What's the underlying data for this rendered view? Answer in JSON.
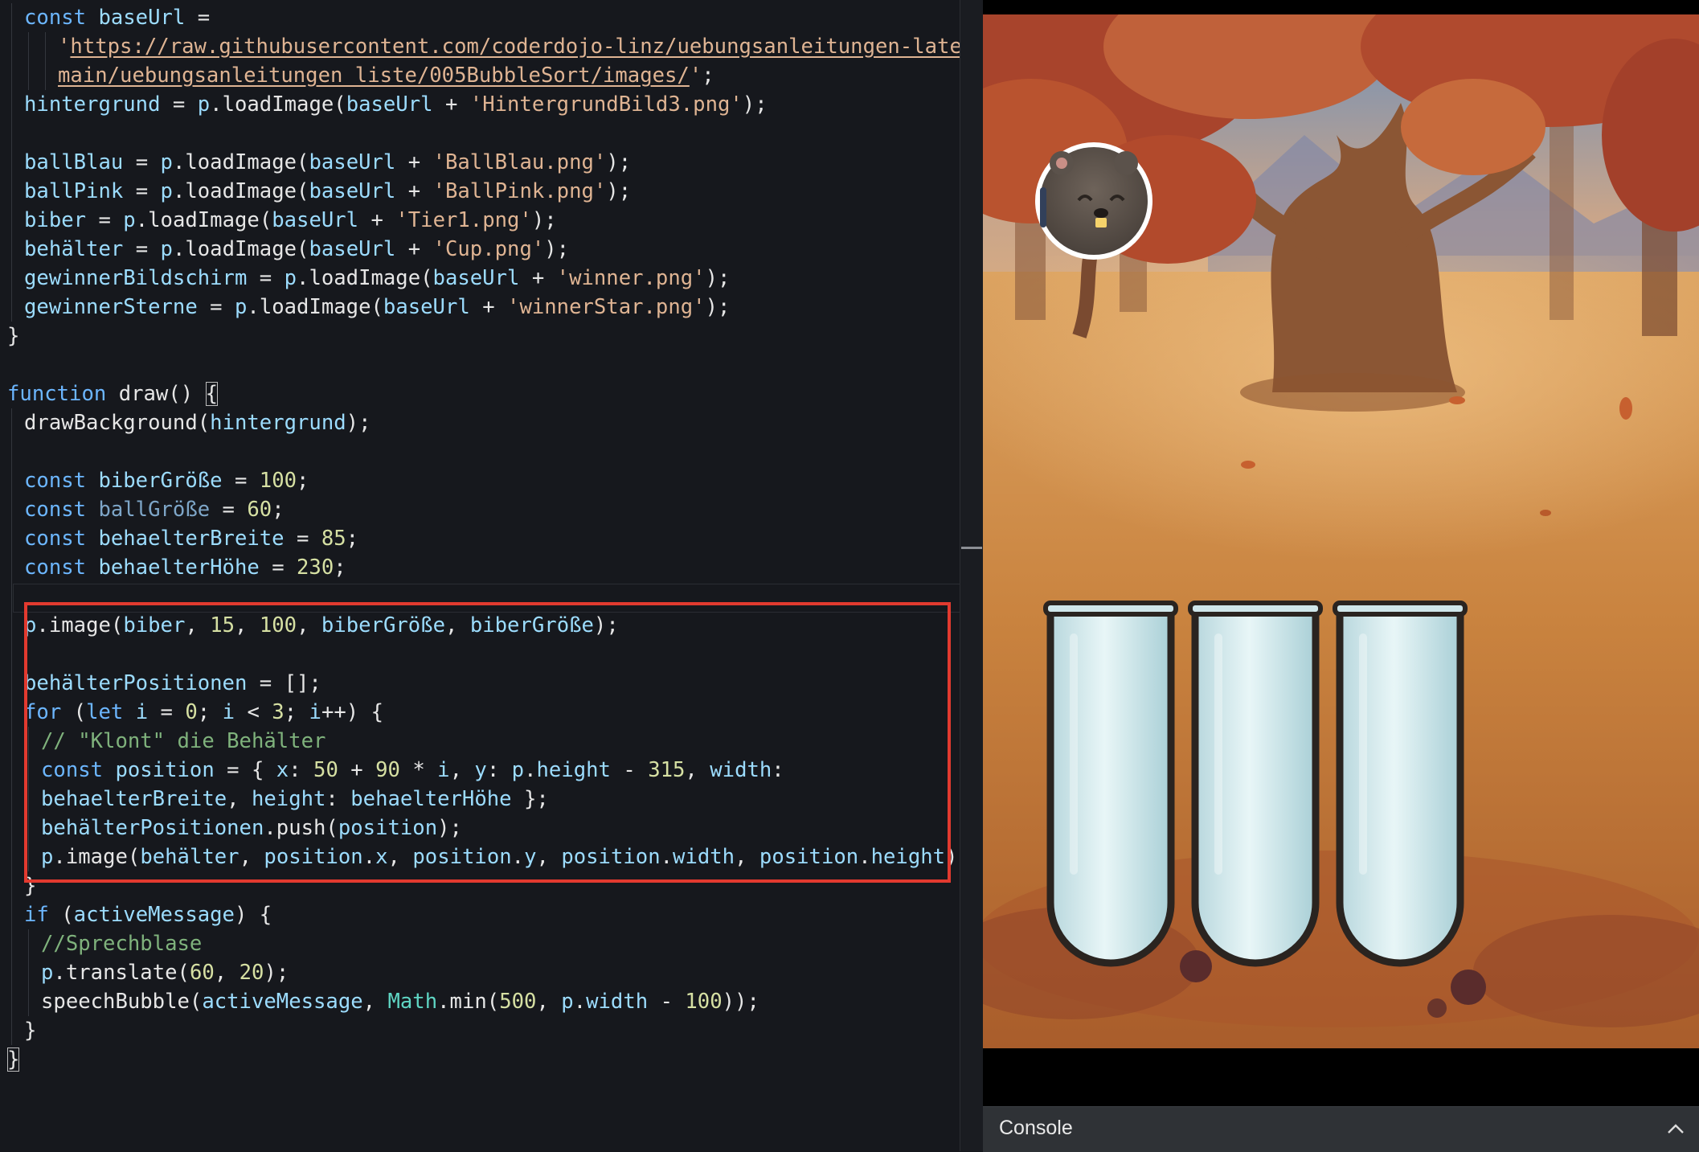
{
  "editor": {
    "language": "javascript",
    "lines": [
      [
        {
          "t": "const ",
          "c": "kw"
        },
        {
          "t": "baseUrl",
          "c": "var"
        },
        {
          "t": " =",
          "c": "p"
        }
      ],
      [
        {
          "t": "'",
          "c": "str"
        },
        {
          "t": "https://raw.githubusercontent.com/coderdojo-linz/uebungsanleitungen-latex/",
          "c": "url"
        }
      ],
      [
        {
          "t": "main/uebungsanleitungen_liste/005BubbleSort/images/",
          "c": "url"
        },
        {
          "t": "'",
          "c": "str"
        },
        {
          "t": ";",
          "c": "p"
        }
      ],
      [
        {
          "t": "hintergrund",
          "c": "var"
        },
        {
          "t": " = ",
          "c": "p"
        },
        {
          "t": "p",
          "c": "var"
        },
        {
          "t": ".",
          "c": "p"
        },
        {
          "t": "loadImage",
          "c": "fn"
        },
        {
          "t": "(",
          "c": "p"
        },
        {
          "t": "baseUrl",
          "c": "var"
        },
        {
          "t": " + ",
          "c": "p"
        },
        {
          "t": "'HintergrundBild3.png'",
          "c": "str"
        },
        {
          "t": ");",
          "c": "p"
        }
      ],
      [],
      [
        {
          "t": "ballBlau",
          "c": "var"
        },
        {
          "t": " = ",
          "c": "p"
        },
        {
          "t": "p",
          "c": "var"
        },
        {
          "t": ".",
          "c": "p"
        },
        {
          "t": "loadImage",
          "c": "fn"
        },
        {
          "t": "(",
          "c": "p"
        },
        {
          "t": "baseUrl",
          "c": "var"
        },
        {
          "t": " + ",
          "c": "p"
        },
        {
          "t": "'BallBlau.png'",
          "c": "str"
        },
        {
          "t": ");",
          "c": "p"
        }
      ],
      [
        {
          "t": "ballPink",
          "c": "var"
        },
        {
          "t": " = ",
          "c": "p"
        },
        {
          "t": "p",
          "c": "var"
        },
        {
          "t": ".",
          "c": "p"
        },
        {
          "t": "loadImage",
          "c": "fn"
        },
        {
          "t": "(",
          "c": "p"
        },
        {
          "t": "baseUrl",
          "c": "var"
        },
        {
          "t": " + ",
          "c": "p"
        },
        {
          "t": "'BallPink.png'",
          "c": "str"
        },
        {
          "t": ");",
          "c": "p"
        }
      ],
      [
        {
          "t": "biber",
          "c": "var"
        },
        {
          "t": " = ",
          "c": "p"
        },
        {
          "t": "p",
          "c": "var"
        },
        {
          "t": ".",
          "c": "p"
        },
        {
          "t": "loadImage",
          "c": "fn"
        },
        {
          "t": "(",
          "c": "p"
        },
        {
          "t": "baseUrl",
          "c": "var"
        },
        {
          "t": " + ",
          "c": "p"
        },
        {
          "t": "'Tier1.png'",
          "c": "str"
        },
        {
          "t": ");",
          "c": "p"
        }
      ],
      [
        {
          "t": "behälter",
          "c": "var"
        },
        {
          "t": " = ",
          "c": "p"
        },
        {
          "t": "p",
          "c": "var"
        },
        {
          "t": ".",
          "c": "p"
        },
        {
          "t": "loadImage",
          "c": "fn"
        },
        {
          "t": "(",
          "c": "p"
        },
        {
          "t": "baseUrl",
          "c": "var"
        },
        {
          "t": " + ",
          "c": "p"
        },
        {
          "t": "'Cup.png'",
          "c": "str"
        },
        {
          "t": ");",
          "c": "p"
        }
      ],
      [
        {
          "t": "gewinnerBildschirm",
          "c": "var"
        },
        {
          "t": " = ",
          "c": "p"
        },
        {
          "t": "p",
          "c": "var"
        },
        {
          "t": ".",
          "c": "p"
        },
        {
          "t": "loadImage",
          "c": "fn"
        },
        {
          "t": "(",
          "c": "p"
        },
        {
          "t": "baseUrl",
          "c": "var"
        },
        {
          "t": " + ",
          "c": "p"
        },
        {
          "t": "'winner.png'",
          "c": "str"
        },
        {
          "t": ");",
          "c": "p"
        }
      ],
      [
        {
          "t": "gewinnerSterne",
          "c": "var"
        },
        {
          "t": " = ",
          "c": "p"
        },
        {
          "t": "p",
          "c": "var"
        },
        {
          "t": ".",
          "c": "p"
        },
        {
          "t": "loadImage",
          "c": "fn"
        },
        {
          "t": "(",
          "c": "p"
        },
        {
          "t": "baseUrl",
          "c": "var"
        },
        {
          "t": " + ",
          "c": "p"
        },
        {
          "t": "'winnerStar.png'",
          "c": "str"
        },
        {
          "t": ");",
          "c": "p"
        }
      ],
      [
        {
          "t": "}",
          "c": "p"
        }
      ],
      [],
      [
        {
          "t": "function ",
          "c": "kw"
        },
        {
          "t": "draw",
          "c": "fn"
        },
        {
          "t": "() ",
          "c": "p"
        },
        {
          "t": "{",
          "c": "p",
          "cursor": true
        }
      ],
      [
        {
          "t": "drawBackground",
          "c": "fn"
        },
        {
          "t": "(",
          "c": "p"
        },
        {
          "t": "hintergrund",
          "c": "var"
        },
        {
          "t": ");",
          "c": "p"
        }
      ],
      [],
      [
        {
          "t": "const ",
          "c": "kw"
        },
        {
          "t": "biberGröße",
          "c": "var"
        },
        {
          "t": " = ",
          "c": "p"
        },
        {
          "t": "100",
          "c": "num"
        },
        {
          "t": ";",
          "c": "p"
        }
      ],
      [
        {
          "t": "const ",
          "c": "kw"
        },
        {
          "t": "ballGröße",
          "c": "dim"
        },
        {
          "t": " = ",
          "c": "p"
        },
        {
          "t": "60",
          "c": "num"
        },
        {
          "t": ";",
          "c": "p"
        }
      ],
      [
        {
          "t": "const ",
          "c": "kw"
        },
        {
          "t": "behaelterBreite",
          "c": "var"
        },
        {
          "t": " = ",
          "c": "p"
        },
        {
          "t": "85",
          "c": "num"
        },
        {
          "t": ";",
          "c": "p"
        }
      ],
      [
        {
          "t": "const ",
          "c": "kw"
        },
        {
          "t": "behaelterHöhe",
          "c": "var"
        },
        {
          "t": " = ",
          "c": "p"
        },
        {
          "t": "230",
          "c": "num"
        },
        {
          "t": ";",
          "c": "p"
        }
      ],
      [],
      [
        {
          "t": "p",
          "c": "var"
        },
        {
          "t": ".",
          "c": "p"
        },
        {
          "t": "image",
          "c": "fn"
        },
        {
          "t": "(",
          "c": "p"
        },
        {
          "t": "biber",
          "c": "var"
        },
        {
          "t": ", ",
          "c": "p"
        },
        {
          "t": "15",
          "c": "num"
        },
        {
          "t": ", ",
          "c": "p"
        },
        {
          "t": "100",
          "c": "num"
        },
        {
          "t": ", ",
          "c": "p"
        },
        {
          "t": "biberGröße",
          "c": "var"
        },
        {
          "t": ", ",
          "c": "p"
        },
        {
          "t": "biberGröße",
          "c": "var"
        },
        {
          "t": ");",
          "c": "p"
        }
      ],
      [],
      [
        {
          "t": "behälterPositionen",
          "c": "var"
        },
        {
          "t": " = [];",
          "c": "p"
        }
      ],
      [
        {
          "t": "for ",
          "c": "kw"
        },
        {
          "t": "(",
          "c": "p"
        },
        {
          "t": "let ",
          "c": "kw"
        },
        {
          "t": "i",
          "c": "var"
        },
        {
          "t": " = ",
          "c": "p"
        },
        {
          "t": "0",
          "c": "num"
        },
        {
          "t": "; ",
          "c": "p"
        },
        {
          "t": "i",
          "c": "var"
        },
        {
          "t": " < ",
          "c": "p"
        },
        {
          "t": "3",
          "c": "num"
        },
        {
          "t": "; ",
          "c": "p"
        },
        {
          "t": "i",
          "c": "var"
        },
        {
          "t": "++) {",
          "c": "p"
        }
      ],
      [
        {
          "t": "// \"Klont\" die Behälter",
          "c": "cmt"
        }
      ],
      [
        {
          "t": "const ",
          "c": "kw"
        },
        {
          "t": "position",
          "c": "var"
        },
        {
          "t": " = { ",
          "c": "p"
        },
        {
          "t": "x",
          "c": "var"
        },
        {
          "t": ": ",
          "c": "p"
        },
        {
          "t": "50",
          "c": "num"
        },
        {
          "t": " + ",
          "c": "p"
        },
        {
          "t": "90",
          "c": "num"
        },
        {
          "t": " * ",
          "c": "p"
        },
        {
          "t": "i",
          "c": "var"
        },
        {
          "t": ", ",
          "c": "p"
        },
        {
          "t": "y",
          "c": "var"
        },
        {
          "t": ": ",
          "c": "p"
        },
        {
          "t": "p",
          "c": "var"
        },
        {
          "t": ".",
          "c": "p"
        },
        {
          "t": "height",
          "c": "var"
        },
        {
          "t": " - ",
          "c": "p"
        },
        {
          "t": "315",
          "c": "num"
        },
        {
          "t": ", ",
          "c": "p"
        },
        {
          "t": "width",
          "c": "var"
        },
        {
          "t": ":",
          "c": "p"
        }
      ],
      [
        {
          "t": "behaelterBreite",
          "c": "var"
        },
        {
          "t": ", ",
          "c": "p"
        },
        {
          "t": "height",
          "c": "var"
        },
        {
          "t": ": ",
          "c": "p"
        },
        {
          "t": "behaelterHöhe",
          "c": "var"
        },
        {
          "t": " };",
          "c": "p"
        }
      ],
      [
        {
          "t": "behälterPositionen",
          "c": "var"
        },
        {
          "t": ".",
          "c": "p"
        },
        {
          "t": "push",
          "c": "fn"
        },
        {
          "t": "(",
          "c": "p"
        },
        {
          "t": "position",
          "c": "var"
        },
        {
          "t": ");",
          "c": "p"
        }
      ],
      [
        {
          "t": "p",
          "c": "var"
        },
        {
          "t": ".",
          "c": "p"
        },
        {
          "t": "image",
          "c": "fn"
        },
        {
          "t": "(",
          "c": "p"
        },
        {
          "t": "behälter",
          "c": "var"
        },
        {
          "t": ", ",
          "c": "p"
        },
        {
          "t": "position",
          "c": "var"
        },
        {
          "t": ".",
          "c": "p"
        },
        {
          "t": "x",
          "c": "var"
        },
        {
          "t": ", ",
          "c": "p"
        },
        {
          "t": "position",
          "c": "var"
        },
        {
          "t": ".",
          "c": "p"
        },
        {
          "t": "y",
          "c": "var"
        },
        {
          "t": ", ",
          "c": "p"
        },
        {
          "t": "position",
          "c": "var"
        },
        {
          "t": ".",
          "c": "p"
        },
        {
          "t": "width",
          "c": "var"
        },
        {
          "t": ", ",
          "c": "p"
        },
        {
          "t": "position",
          "c": "var"
        },
        {
          "t": ".",
          "c": "p"
        },
        {
          "t": "height",
          "c": "var"
        },
        {
          "t": ");",
          "c": "p"
        }
      ],
      [
        {
          "t": "}",
          "c": "p"
        }
      ],
      [
        {
          "t": "if ",
          "c": "kw"
        },
        {
          "t": "(",
          "c": "p"
        },
        {
          "t": "activeMessage",
          "c": "var"
        },
        {
          "t": ") {",
          "c": "p"
        }
      ],
      [
        {
          "t": "//Sprechblase",
          "c": "cmt"
        }
      ],
      [
        {
          "t": "p",
          "c": "var"
        },
        {
          "t": ".",
          "c": "p"
        },
        {
          "t": "translate",
          "c": "fn"
        },
        {
          "t": "(",
          "c": "p"
        },
        {
          "t": "60",
          "c": "num"
        },
        {
          "t": ", ",
          "c": "p"
        },
        {
          "t": "20",
          "c": "num"
        },
        {
          "t": ");",
          "c": "p"
        }
      ],
      [
        {
          "t": "speechBubble",
          "c": "fn"
        },
        {
          "t": "(",
          "c": "p"
        },
        {
          "t": "activeMessage",
          "c": "var"
        },
        {
          "t": ", ",
          "c": "p"
        },
        {
          "t": "Math",
          "c": "bi"
        },
        {
          "t": ".",
          "c": "p"
        },
        {
          "t": "min",
          "c": "fn"
        },
        {
          "t": "(",
          "c": "p"
        },
        {
          "t": "500",
          "c": "num"
        },
        {
          "t": ", ",
          "c": "p"
        },
        {
          "t": "p",
          "c": "var"
        },
        {
          "t": ".",
          "c": "p"
        },
        {
          "t": "width",
          "c": "var"
        },
        {
          "t": " - ",
          "c": "p"
        },
        {
          "t": "100",
          "c": "num"
        },
        {
          "t": "));",
          "c": "p"
        }
      ],
      [
        {
          "t": "}",
          "c": "p"
        }
      ],
      [
        {
          "t": "}",
          "c": "p",
          "cursor": true
        }
      ]
    ]
  },
  "preview": {
    "scene": "autumn-forest-background",
    "character": "beaver-avatar",
    "container_count": 3
  },
  "console": {
    "label": "Console",
    "toggle_icon": "chevron-up-icon"
  },
  "colors": {
    "highlight_border": "#e23a2f",
    "editor_bg": "#16181d",
    "container_fill": "#cfe6ea",
    "container_outline": "#2a2420"
  }
}
